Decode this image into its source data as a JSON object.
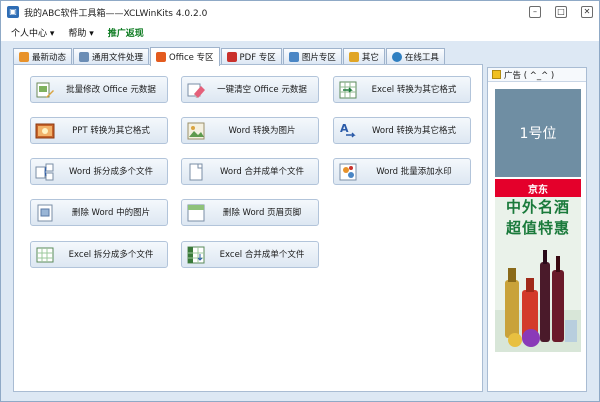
{
  "window": {
    "title": "我的ABC软件工具箱——XCLWinKits   4.0.2.0",
    "app_icon": "app-logo-icon",
    "controls": [
      "minimize-icon",
      "maximize-icon",
      "close-icon"
    ]
  },
  "menu": {
    "items": [
      {
        "label": "个人中心 ▾"
      },
      {
        "label": "帮助 ▾"
      },
      {
        "label": "推广返现"
      }
    ]
  },
  "tabs": [
    {
      "label": "最新动态",
      "icon": "rss-icon",
      "color": "#e8922a"
    },
    {
      "label": "通用文件处理",
      "icon": "file-icon",
      "color": "#6b8db5"
    },
    {
      "label": "Office 专区",
      "icon": "office-icon",
      "color": "#e35b1f",
      "active": true
    },
    {
      "label": "PDF 专区",
      "icon": "pdf-icon",
      "color": "#c9302c"
    },
    {
      "label": "图片专区",
      "icon": "image-icon",
      "color": "#4a86c5"
    },
    {
      "label": "其它",
      "icon": "folder-icon",
      "color": "#e0a526"
    },
    {
      "label": "在线工具",
      "icon": "globe-icon",
      "color": "#2f7fc1"
    }
  ],
  "features": [
    {
      "label": "批量修改 Office 元数据",
      "icon": "edit-metadata-icon"
    },
    {
      "label": "一键清空 Office 元数据",
      "icon": "eraser-icon"
    },
    {
      "label": "Excel 转换为其它格式",
      "icon": "excel-convert-icon"
    },
    {
      "label": "PPT 转换为其它格式",
      "icon": "ppt-icon"
    },
    {
      "label": "Word 转换为图片",
      "icon": "word-image-icon"
    },
    {
      "label": "Word 转换为其它格式",
      "icon": "word-convert-icon"
    },
    {
      "label": "Word 拆分成多个文件",
      "icon": "split-icon"
    },
    {
      "label": "Word 合并成单个文件",
      "icon": "merge-icon"
    },
    {
      "label": "Word 批量添加水印",
      "icon": "watermark-icon"
    },
    {
      "label": "删除 Word 中的图片",
      "icon": "delete-image-icon"
    },
    {
      "label": "删除 Word 页眉页脚",
      "icon": "header-footer-icon"
    },
    {
      "label": "Excel 拆分成多个文件",
      "icon": "excel-split-icon"
    },
    {
      "label": "Excel 合并成单个文件",
      "icon": "excel-merge-icon"
    }
  ],
  "ads": {
    "title": "广告 ( ^_^ )",
    "slot1": "1号位",
    "slot2_brand": "京东",
    "slot2_line1": "中外名酒",
    "slot2_line2": "超值特惠"
  },
  "colors": {
    "accent_green": "#0b7a1f",
    "button_border": "#b2c4da",
    "frame_bg": "#dde8f4"
  }
}
